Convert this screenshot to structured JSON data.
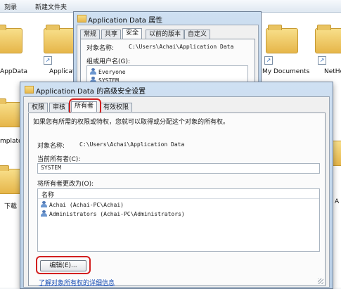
{
  "explorer": {
    "toolbar": {
      "burn": "刻录",
      "new_folder": "新建文件夹"
    },
    "folders": [
      {
        "label": "AppData"
      },
      {
        "label": "Applicatio"
      },
      {
        "label": "My Documents"
      },
      {
        "label": "NetHo"
      },
      {
        "label": "mplate"
      },
      {
        "label": "下载"
      }
    ],
    "side_letter": "A"
  },
  "properties_window": {
    "title": "Application Data 属性",
    "tabs": [
      "常规",
      "共享",
      "安全",
      "以前的版本",
      "自定义"
    ],
    "active_tab": 2,
    "object_label": "对象名称:",
    "object_value": "C:\\Users\\Achai\\Application Data",
    "group_label": "组或用户名(G):",
    "groups": [
      "Everyone",
      "SYSTEM"
    ]
  },
  "advanced_window": {
    "title": "Application Data 的高级安全设置",
    "tabs": [
      "权限",
      "审核",
      "所有者",
      "有效权限"
    ],
    "active_tab": 2,
    "intro": "如果您有所需的权限或特权，您就可以取得或分配这个对象的所有权。",
    "object_label": "对象名称:",
    "object_value": "C:\\Users\\Achai\\Application Data",
    "current_owner_label": "当前所有者(C):",
    "current_owner_value": "SYSTEM",
    "change_owner_label": "将所有者更改为(O):",
    "column_name": "名称",
    "owners": [
      "Achai (Achai-PC\\Achai)",
      "Administrators (Achai-PC\\Administrators)"
    ],
    "edit_button": "编辑(E)...",
    "learn_link": "了解对象所有权的详细信息"
  }
}
